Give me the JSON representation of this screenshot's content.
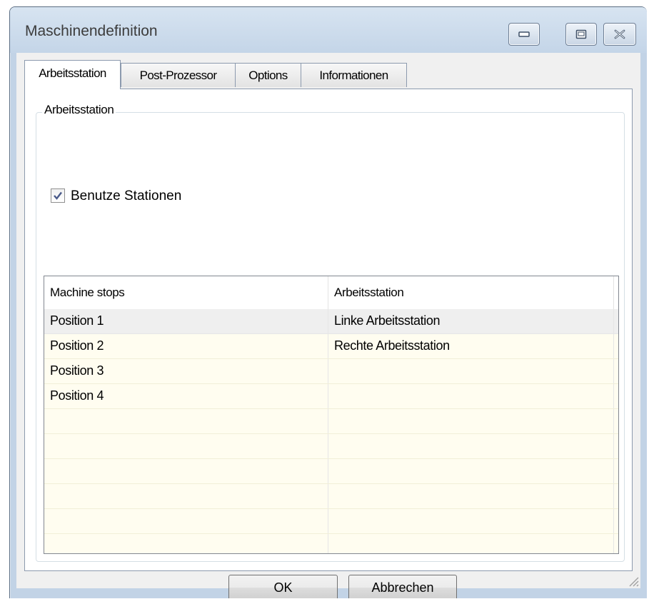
{
  "window": {
    "title": "Maschinendefinition",
    "controls": [
      "minimize-icon",
      "maximize-icon",
      "close-icon"
    ]
  },
  "tabs": [
    {
      "label": "Arbeitsstation",
      "active": true
    },
    {
      "label": "Post-Prozessor",
      "active": false
    },
    {
      "label": "Options",
      "active": false
    },
    {
      "label": "Informationen",
      "active": false
    }
  ],
  "group": {
    "title": "Arbeitsstation",
    "checkbox": {
      "label": "Benutze Stationen",
      "checked": true
    }
  },
  "grid": {
    "columns": [
      "Machine stops",
      "Arbeitsstation"
    ],
    "rows": [
      [
        "Position 1",
        "Linke Arbeitsstation"
      ],
      [
        "Position 2",
        "Rechte Arbeitsstation"
      ],
      [
        "Position 3",
        ""
      ],
      [
        "Position 4",
        ""
      ],
      [
        "",
        ""
      ],
      [
        "",
        ""
      ],
      [
        "",
        ""
      ],
      [
        "",
        ""
      ],
      [
        "",
        ""
      ],
      [
        "",
        ""
      ]
    ],
    "selected_row": 0,
    "colors": {
      "row_bg": "#fffdf0",
      "selected_bg": "#efefef"
    }
  },
  "buttons": {
    "ok": "OK",
    "cancel": "Abbrechen"
  }
}
